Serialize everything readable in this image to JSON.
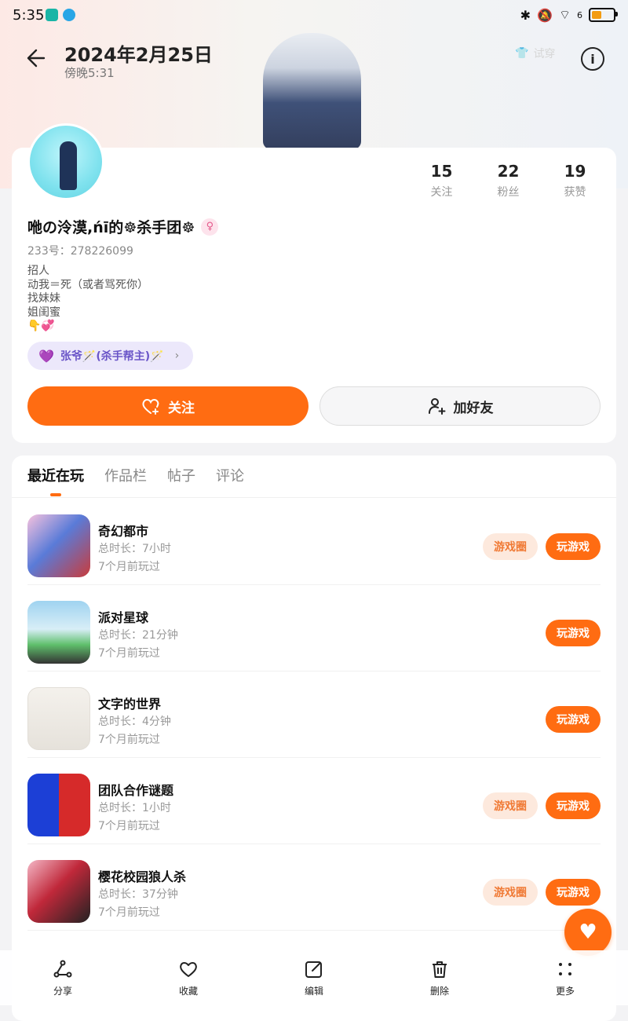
{
  "status_bar": {
    "time": "5:35",
    "signal_label": "6"
  },
  "header": {
    "title": "2024年2月25日",
    "subtitle": "傍晚5:31",
    "tryon_label": "试穿"
  },
  "profile": {
    "stats": [
      {
        "num": "15",
        "label": "关注"
      },
      {
        "num": "22",
        "label": "粉丝"
      },
      {
        "num": "19",
        "label": "获赞"
      }
    ],
    "username": "咃の泠漠,ńī的☸杀手团☸",
    "uid": "233号：278226099",
    "bio": "招人\n动我＝死（或者骂死你）\n找妹妹\n姐闺蜜\n👇💞",
    "guild": "张爷🪄(杀手帮主)🪄",
    "follow_label": "关注",
    "add_friend_label": "加好友"
  },
  "tabs": [
    "最近在玩",
    "作品栏",
    "帖子",
    "评论"
  ],
  "games": [
    {
      "name": "奇幻都市",
      "time": "总时长：7小时",
      "last": "7个月前玩过",
      "circle": "游戏圈",
      "play": "玩游戏"
    },
    {
      "name": "派对星球",
      "time": "总时长：21分钟",
      "last": "7个月前玩过",
      "circle": "",
      "play": "玩游戏"
    },
    {
      "name": "文字的世界",
      "time": "总时长：4分钟",
      "last": "7个月前玩过",
      "circle": "",
      "play": "玩游戏"
    },
    {
      "name": "团队合作谜题",
      "time": "总时长：1小时",
      "last": "7个月前玩过",
      "circle": "游戏圈",
      "play": "玩游戏"
    },
    {
      "name": "樱花校园狼人杀",
      "time": "总时长：37分钟",
      "last": "7个月前玩过",
      "circle": "游戏圈",
      "play": "玩游戏"
    }
  ],
  "bottom_bar": [
    {
      "label": "分享",
      "icon": "share-icon"
    },
    {
      "label": "收藏",
      "icon": "heart-icon"
    },
    {
      "label": "编辑",
      "icon": "edit-icon"
    },
    {
      "label": "删除",
      "icon": "trash-icon"
    },
    {
      "label": "更多",
      "icon": "more-icon"
    }
  ],
  "colors": {
    "accent": "#ff6c12",
    "accent_soft": "#fde9dd",
    "guild_bg": "#ece8fb"
  }
}
